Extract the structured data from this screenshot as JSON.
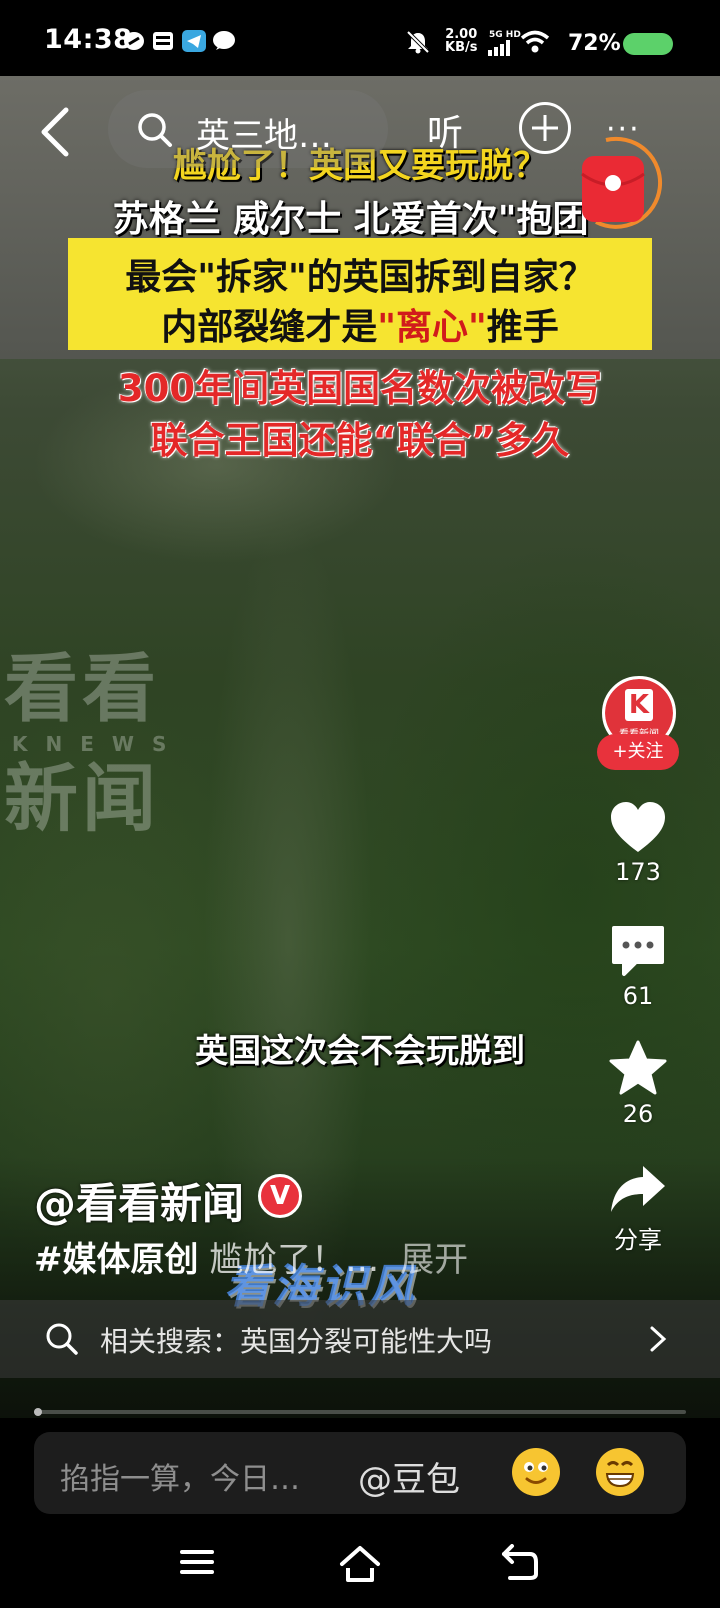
{
  "status_bar": {
    "time": "14:38",
    "net_speed_value": "2.00",
    "net_speed_unit": "KB/s",
    "network_type": "5G HD",
    "battery": "72%"
  },
  "top_nav": {
    "search_text": "英三地…",
    "listen_label": "听"
  },
  "video": {
    "headline_line1": "尴尬了！英国又要玩脱？",
    "headline_line2": "苏格兰  威尔士  北爱首次\"抱团\"",
    "box_line1_a": "最会\"拆家\"的英国拆到自家？",
    "box_line2_a": "内部裂缝才是",
    "box_line2_b": "\"离心\"",
    "box_line2_c": "推手",
    "red_line1": "300年间英国国名数次被改写",
    "red_line2": "联合王国还能“联合”多久",
    "watermark_top": "看看",
    "watermark_mid": "KNEWS",
    "watermark_bottom": "新闻",
    "subtitle": "英国这次会不会玩脱到",
    "overlay_logo": "看海识风"
  },
  "actions": {
    "avatar_name": "看看新闻",
    "follow_label": "+关注",
    "likes": "173",
    "comments": "61",
    "favorites": "26",
    "share_label": "分享"
  },
  "post": {
    "author": "@看看新闻",
    "verified_mark": "V",
    "hashtag": "#媒体原创",
    "caption_text": "尴尬了！…",
    "expand_label": "展开"
  },
  "related": {
    "text": "相关搜索：英国分裂可能性大吗"
  },
  "input_bar": {
    "placeholder": "掐指一算，今日…",
    "mention": "@豆包"
  },
  "colors": {
    "accent_red": "#e8323c",
    "headline_yellow": "#f3d51f",
    "box_yellow": "#f6e430",
    "battery_green": "#5cd16a"
  }
}
